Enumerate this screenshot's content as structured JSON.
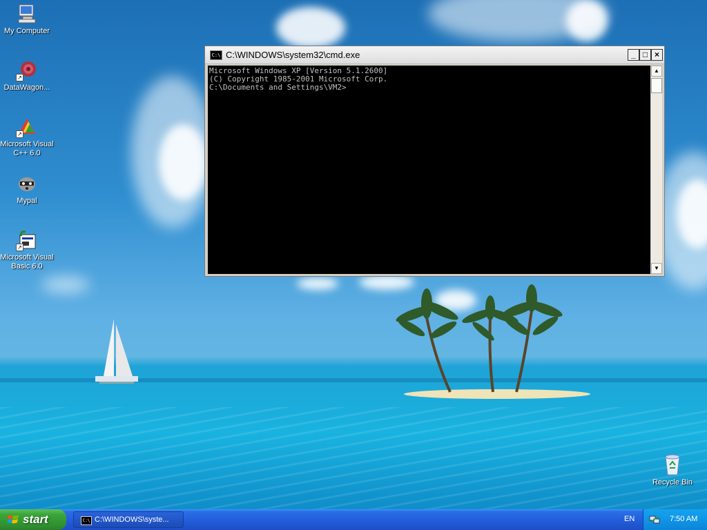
{
  "desktop": {
    "icons": [
      {
        "label": "My Computer",
        "icon": "my-computer-icon"
      },
      {
        "label": "DataWagon...",
        "icon": "datawagon-icon"
      },
      {
        "label": "Microsoft Visual C++ 6.0",
        "icon": "visual-cpp-icon"
      },
      {
        "label": "Mypal",
        "icon": "mypal-raccoon-icon"
      },
      {
        "label": "Microsoft Visual Basic 6.0",
        "icon": "visual-basic-icon"
      },
      {
        "label": "Recycle Bin",
        "icon": "recycle-bin-icon"
      }
    ]
  },
  "cmd_window": {
    "title": "C:\\WINDOWS\\system32\\cmd.exe",
    "icon_text": "C:\\",
    "controls": {
      "minimize": "_",
      "maximize": "□",
      "close": "×"
    },
    "console_lines": [
      "Microsoft Windows XP [Version 5.1.2600]",
      "(C) Copyright 1985-2001 Microsoft Corp.",
      "",
      "C:\\Documents and Settings\\VM2>"
    ]
  },
  "taskbar": {
    "start_label": "start",
    "tasks": [
      {
        "label": "C:\\WINDOWS\\syste...",
        "icon_text": "C:\\"
      }
    ],
    "language": "EN",
    "clock": "7:50 AM"
  },
  "colors": {
    "taskbar_blue": "#225bd8",
    "start_green": "#39a639",
    "console_bg": "#000000",
    "console_text": "#c0c0c0"
  }
}
